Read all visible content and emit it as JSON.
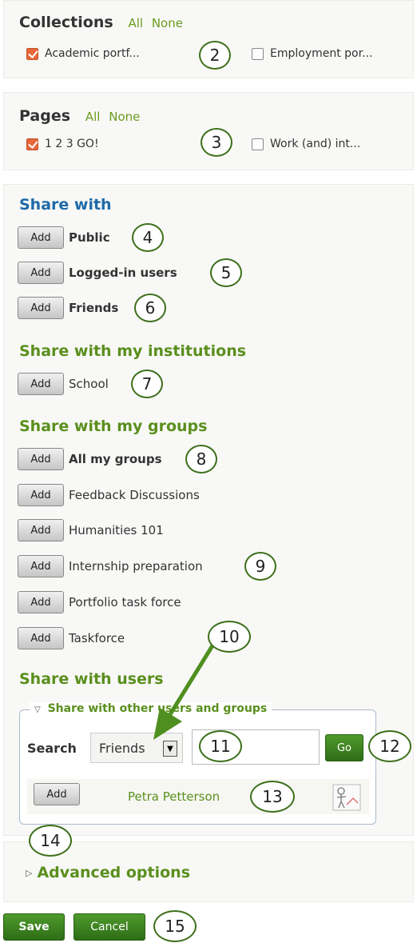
{
  "collections": {
    "title": "Collections",
    "all": "All",
    "none": "None",
    "items": [
      {
        "label": "Academic portf...",
        "checked": true
      },
      {
        "label": "Employment por...",
        "checked": false
      }
    ]
  },
  "pages": {
    "title": "Pages",
    "all": "All",
    "none": "None",
    "items": [
      {
        "label": "1 2 3 GO!",
        "checked": true
      },
      {
        "label": "Work (and) int...",
        "checked": false
      }
    ]
  },
  "add_label": "Add",
  "share_with": {
    "title": "Share with",
    "items": [
      "Public",
      "Logged-in users",
      "Friends"
    ]
  },
  "institutions": {
    "title": "Share with my institutions",
    "items": [
      "School"
    ]
  },
  "groups": {
    "title": "Share with my groups",
    "items": [
      "All my groups",
      "Feedback Discussions",
      "Humanities 101",
      "Internship preparation",
      "Portfolio task force",
      "Taskforce"
    ]
  },
  "users": {
    "title": "Share with users",
    "legend": "Share with other users and groups",
    "search_label": "Search",
    "search_scope": "Friends",
    "search_value": "",
    "go_label": "Go",
    "result_name": "Petra Petterson"
  },
  "advanced": {
    "label": "Advanced options"
  },
  "actions": {
    "save": "Save",
    "cancel": "Cancel"
  },
  "callouts": [
    "2",
    "3",
    "4",
    "5",
    "6",
    "7",
    "8",
    "9",
    "10",
    "11",
    "12",
    "13",
    "14",
    "15"
  ],
  "colors": {
    "accent_green": "#5a8f1d",
    "share_blue": "#1f6aa8",
    "checkbox_orange": "#e7673a",
    "callout_border": "#3c6f1a"
  }
}
